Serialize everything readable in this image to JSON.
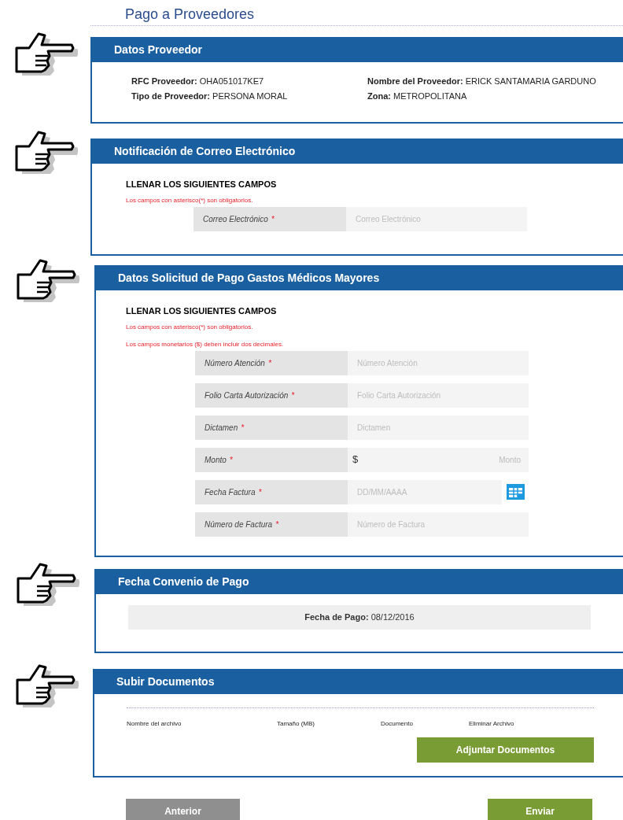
{
  "title": "Pago a Proveedores",
  "provider": {
    "title": "Datos Proveedor",
    "fields": [
      {
        "label": "RFC Proveedor:",
        "value": "OHA051017KE7"
      },
      {
        "label": "Nombre del Proveedor:",
        "value": "ERICK SANTAMARIA GARDUNO"
      },
      {
        "label": "Tipo de Proveedor:",
        "value": "PERSONA MORAL"
      },
      {
        "label": "Zona:",
        "value": "METROPOLITANA"
      }
    ]
  },
  "email": {
    "title": "Notificación de Correo Electrónico",
    "heading": "LLENAR LOS SIGUIENTES CAMPOS",
    "notes": [
      "Los campos con asterisco(*) son obligatorios."
    ],
    "fields": [
      {
        "kind": "text",
        "label": "Correo Electrónico",
        "mark": "*",
        "placeholder": "Correo Electrónico"
      }
    ]
  },
  "payment": {
    "title": "Datos Solicitud de Pago Gastos Médicos Mayores",
    "heading": "LLENAR LOS SIGUIENTES CAMPOS",
    "notes": [
      "Los campos con asterisco(*) son obligatorios.",
      "Los campos monetarios ($) deben incluir dos decimales."
    ],
    "fields": [
      {
        "kind": "text",
        "label": "Número Atención",
        "mark": "*",
        "placeholder": "Número Atención"
      },
      {
        "kind": "text",
        "label": "Folio Carta Autorización",
        "mark": "*",
        "placeholder": "Folio Carta Autorización"
      },
      {
        "kind": "text",
        "label": "Dictamen",
        "mark": "*",
        "placeholder": "Dictamen"
      },
      {
        "kind": "money",
        "label": "Monto",
        "mark": "*",
        "prefix": "$",
        "placeholder": "Monto"
      },
      {
        "kind": "date",
        "label": "Fecha Factura",
        "mark": "*",
        "placeholder": "DD/MM/AAAA"
      },
      {
        "kind": "text",
        "label": "Número de Factura",
        "mark": "*",
        "placeholder": "Número de Factura"
      }
    ]
  },
  "agreement": {
    "title": "Fecha Convenio de Pago",
    "text": "**Fecha de Pago:** 08/12/2016"
  },
  "upload": {
    "title": "Subir Documentos",
    "columns": [
      "Nombre del archivo",
      "Tamaño (MB)",
      "Documento",
      "Eliminar Archivo"
    ],
    "button": "Adjuntar Documentos"
  },
  "buttons": [
    {
      "kind": "secondary",
      "label": "Anterior"
    },
    {
      "kind": "primary",
      "label": "Enviar"
    }
  ]
}
